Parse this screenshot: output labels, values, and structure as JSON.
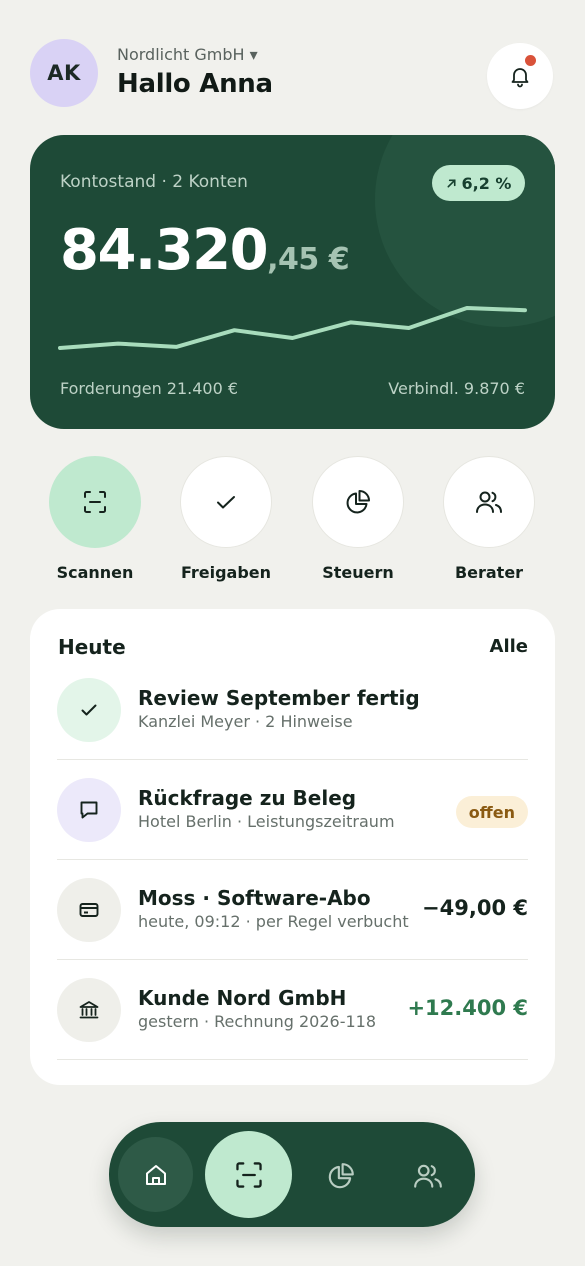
{
  "header": {
    "avatar_initials": "AK",
    "company": "Nordlicht GmbH ▾",
    "greeting": "Hallo Anna",
    "notification_icon": "bell-icon",
    "has_unread": true
  },
  "balance_card": {
    "label": "Kontostand · 2 Konten",
    "trend": "6,2 %",
    "trend_icon": "arrow-up-right-icon",
    "balance_main": "84.320",
    "balance_cents": ",45 €",
    "receivables": "Forderungen 21.400 €",
    "payables": "Verbindl. 9.870 €",
    "sparkline": [
      18,
      22,
      19,
      34,
      27,
      41,
      36,
      54,
      52
    ],
    "colors": {
      "card": "#1e4a37",
      "line": "#a8dcbc"
    }
  },
  "quick_actions": [
    {
      "label": "Scannen",
      "icon": "scan-icon",
      "active": true
    },
    {
      "label": "Freigaben",
      "icon": "check-icon",
      "active": false
    },
    {
      "label": "Steuern",
      "icon": "pie-chart-icon",
      "active": false
    },
    {
      "label": "Berater",
      "icon": "users-icon",
      "active": false
    }
  ],
  "today": {
    "title": "Heute",
    "all_label": "Alle",
    "items": [
      {
        "title": "Review September fertig",
        "subtitle": "Kanzlei Meyer · 2 Hinweise",
        "icon": "check-icon"
      },
      {
        "title": "Rückfrage zu Beleg",
        "subtitle": "Hotel Berlin · Leistungszeitraum",
        "icon": "message-icon",
        "badge": "offen"
      },
      {
        "title": "Moss · Software-Abo",
        "subtitle": "heute, 09:12 · per Regel verbucht",
        "icon": "card-icon",
        "amount": "−49,00 €"
      },
      {
        "title": "Kunde Nord GmbH",
        "subtitle": "gestern · Rechnung 2026-118",
        "icon": "bank-icon",
        "amount": "+12.400 €"
      }
    ]
  },
  "bottom_nav": [
    {
      "icon": "home-icon",
      "selected": true
    },
    {
      "icon": "scan-icon",
      "primary": true
    },
    {
      "icon": "pie-chart-icon"
    },
    {
      "icon": "users-icon"
    }
  ]
}
